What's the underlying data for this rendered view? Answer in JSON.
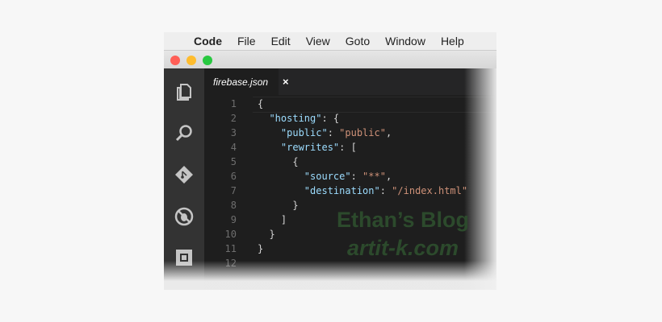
{
  "menubar": {
    "apple": "",
    "app": "Code",
    "items": [
      "File",
      "Edit",
      "View",
      "Goto",
      "Window",
      "Help"
    ]
  },
  "tab": {
    "label": "firebase.json",
    "close": "×"
  },
  "lines": [
    {
      "n": "1",
      "parts": [
        [
          "p",
          "{"
        ]
      ]
    },
    {
      "n": "2",
      "parts": [
        [
          "p",
          "  "
        ],
        [
          "k",
          "\"hosting\""
        ],
        [
          "p",
          ": {"
        ]
      ]
    },
    {
      "n": "3",
      "parts": [
        [
          "p",
          "    "
        ],
        [
          "k",
          "\"public\""
        ],
        [
          "p",
          ": "
        ],
        [
          "s",
          "\"public\""
        ],
        [
          "p",
          ","
        ]
      ]
    },
    {
      "n": "4",
      "parts": [
        [
          "p",
          "    "
        ],
        [
          "k",
          "\"rewrites\""
        ],
        [
          "p",
          ": ["
        ]
      ]
    },
    {
      "n": "5",
      "parts": [
        [
          "p",
          "      {"
        ]
      ]
    },
    {
      "n": "6",
      "parts": [
        [
          "p",
          "        "
        ],
        [
          "k",
          "\"source\""
        ],
        [
          "p",
          ": "
        ],
        [
          "s",
          "\"**\""
        ],
        [
          "p",
          ","
        ]
      ]
    },
    {
      "n": "7",
      "parts": [
        [
          "p",
          "        "
        ],
        [
          "k",
          "\"destination\""
        ],
        [
          "p",
          ": "
        ],
        [
          "s",
          "\"/index.html\""
        ]
      ]
    },
    {
      "n": "8",
      "parts": [
        [
          "p",
          "      }"
        ]
      ]
    },
    {
      "n": "9",
      "parts": [
        [
          "p",
          "    ]"
        ]
      ]
    },
    {
      "n": "10",
      "parts": [
        [
          "p",
          "  }"
        ]
      ]
    },
    {
      "n": "11",
      "parts": [
        [
          "p",
          "}"
        ]
      ]
    },
    {
      "n": "12",
      "parts": []
    }
  ],
  "watermark": {
    "line1": "Ethan’s Blog",
    "line2": "artit-k.com"
  },
  "colors": {
    "close": "#ff5f57",
    "minimize": "#febc2e",
    "maximize": "#28c840",
    "key": "#9cdcfe",
    "string": "#ce9178"
  }
}
